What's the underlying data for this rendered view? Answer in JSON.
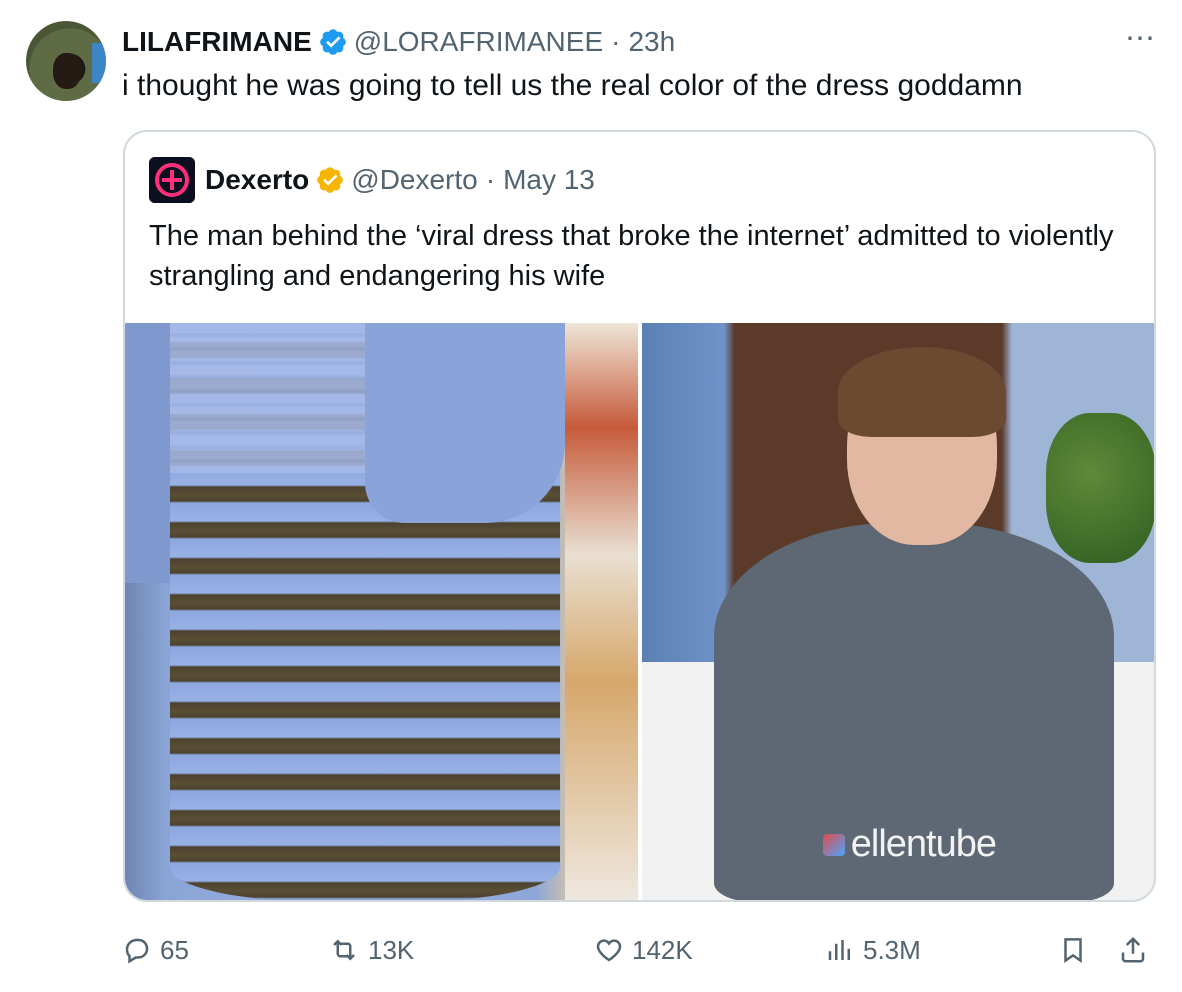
{
  "tweet": {
    "author": {
      "name": "LILAFRIMANE",
      "handle": "@LORAFRIMANEE",
      "time": "23h"
    },
    "text": "i thought he was going to tell us the real color of the dress goddamn",
    "more_icon": "⋯",
    "colors": {
      "verified": "#1d9bf0",
      "text": "#0f1419",
      "muted": "#536471"
    }
  },
  "quoted": {
    "author": {
      "name": "Dexerto",
      "handle": "@Dexerto",
      "time": "May 13"
    },
    "text": "The man behind the ‘viral dress that broke the internet’ admitted to violently strangling and endangering his wife",
    "badge_color": "#f5b500",
    "media": {
      "left_image": "dress-photo",
      "right_image": "man-on-couch-photo",
      "watermark": "ellentube"
    }
  },
  "actions": {
    "replies": "65",
    "reposts": "13K",
    "likes": "142K",
    "views": "5.3M"
  }
}
